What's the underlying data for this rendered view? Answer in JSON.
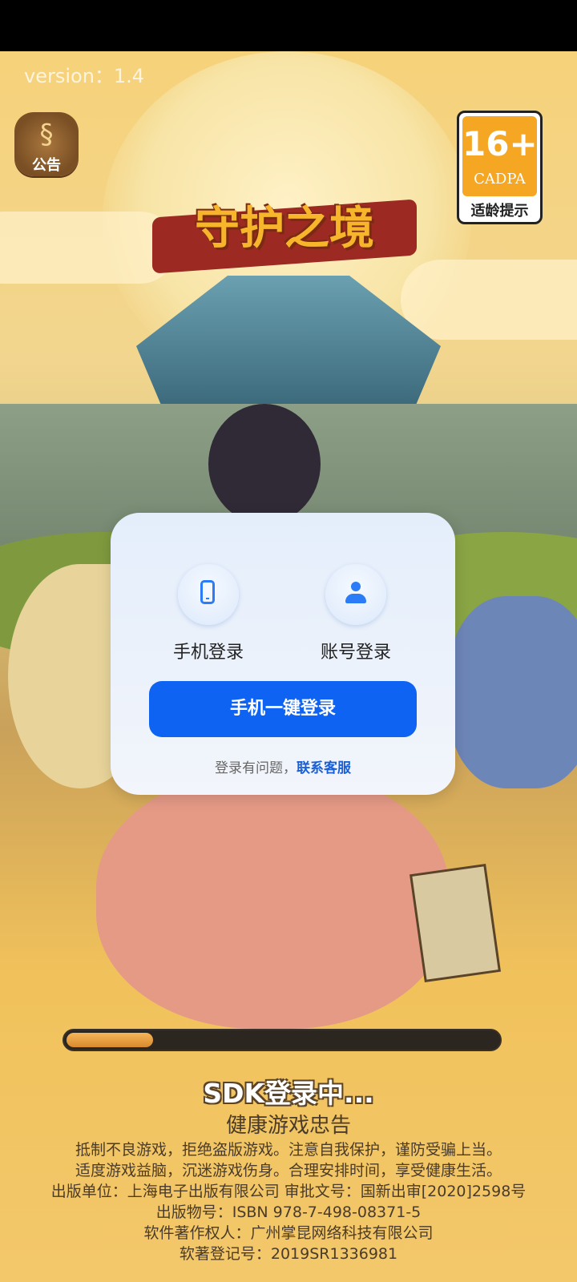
{
  "version": "version：1.4",
  "notice": {
    "label": "公告",
    "icon": "scroll-icon"
  },
  "age_rating": {
    "value": "16+",
    "org": "CADPA",
    "tip": "适龄提示",
    "color": "#f5a623"
  },
  "game_logo": "守护之境",
  "login_dialog": {
    "phone_login": "手机登录",
    "account_login": "账号登录",
    "one_click": "手机一键登录",
    "help_prefix": "登录有问题，",
    "help_link": "联系客服",
    "accent": "#0f63f2"
  },
  "progress": {
    "fraction": 0.2
  },
  "status_text": "SDK登录中...",
  "health": {
    "title": "健康游戏忠告",
    "lines": [
      "抵制不良游戏，拒绝盗版游戏。注意自我保护，谨防受骗上当。",
      "适度游戏益脑，沉迷游戏伤身。合理安排时间，享受健康生活。",
      "出版单位：上海电子出版有限公司  审批文号：国新出审[2020]2598号",
      "出版物号：ISBN 978-7-498-08371-5",
      "软件著作权人：广州掌昆网络科技有限公司",
      "软著登记号：2019SR1336981"
    ]
  }
}
